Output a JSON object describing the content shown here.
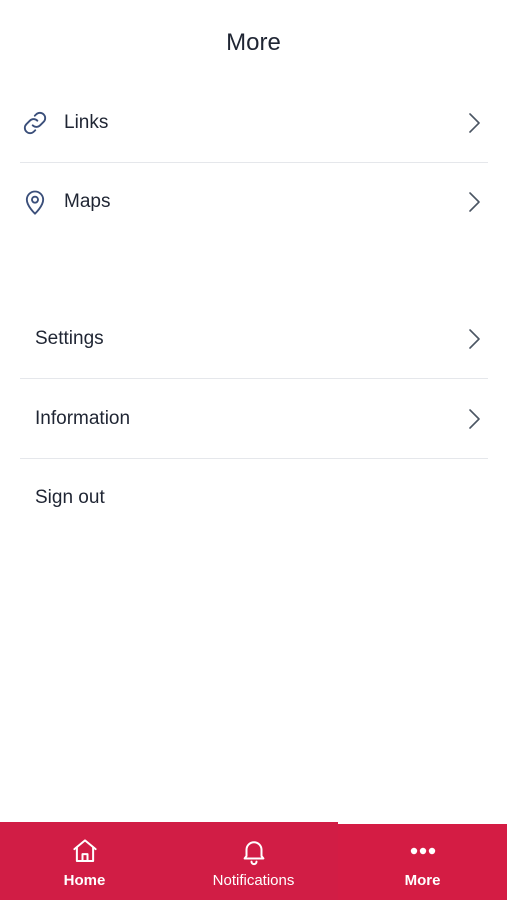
{
  "header": {
    "title": "More"
  },
  "group1": [
    {
      "label": "Links",
      "icon": "link-icon"
    },
    {
      "label": "Maps",
      "icon": "map-pin-icon"
    }
  ],
  "group2": [
    {
      "label": "Settings"
    },
    {
      "label": "Information"
    },
    {
      "label": "Sign out"
    }
  ],
  "tabbar": {
    "tabs": [
      {
        "label": "Home",
        "icon": "home-icon"
      },
      {
        "label": "Notifications",
        "icon": "bell-icon"
      },
      {
        "label": "More",
        "icon": "more-dots-icon"
      }
    ],
    "active": "More"
  },
  "colors": {
    "accent": "#D11D45",
    "icon_blue": "#3B4F7A",
    "divider": "#E5E7EB",
    "text": "#1F2533"
  }
}
